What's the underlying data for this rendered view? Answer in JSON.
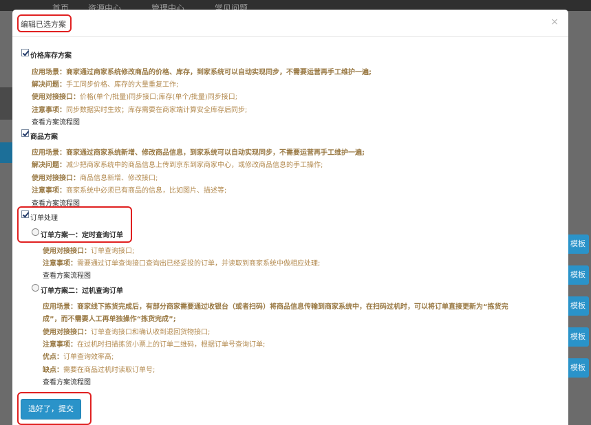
{
  "background": {
    "nav": [
      "首页",
      "资源中心",
      "管理中心",
      "常见问题"
    ],
    "side_button_label": "模板"
  },
  "modal": {
    "title": "编辑已选方案",
    "close_label": "×",
    "sections": [
      {
        "title": "价格库存方案",
        "lines": [
          {
            "label": "应用场景：",
            "text": "商家通过商家系统修改商品的价格、库存，到家系统可以自动实现同步，不需要运营再手工维护一遍;"
          },
          {
            "label": "解决问题：",
            "text": "手工同步价格、库存的大量重复工作;"
          },
          {
            "label": "使用对接接口：",
            "text": "价格(单个/批量)同步接口;库存(单个/批量)同步接口;"
          },
          {
            "label": "注意事项：",
            "text": "同步数据实时生效；库存需要在商家端计算安全库存后同步;"
          }
        ],
        "link": "查看方案流程图"
      },
      {
        "title": "商品方案",
        "lines": [
          {
            "label": "应用场景：",
            "text": "商家通过商家系统新增、修改商品信息，到家系统可以自动实现同步，不需要运营再手工维护一遍;"
          },
          {
            "label": "解决问题：",
            "text": "减少把商家系统中的商品信息上传到京东到家商家中心，或修改商品信息的手工操作;"
          },
          {
            "label": "使用对接接口：",
            "text": "商品信息新增、修改接口;"
          },
          {
            "label": "注意事项：",
            "text": "商家系统中必须已有商品的信息，比如图片、描述等;"
          }
        ],
        "link": "查看方案流程图"
      }
    ],
    "order": {
      "title": "订单处理",
      "option1": {
        "title": "订单方案一：定时查询订单",
        "lines": [
          {
            "label": "使用对接接口：",
            "text": "订单查询接口;"
          },
          {
            "label": "注意事项：",
            "text": "需要通过订单查询接口查询出已经妥投的订单，并读取到商家系统中做相应处理;"
          }
        ],
        "link": "查看方案流程图"
      },
      "option2": {
        "title": "订单方案二：过机查询订单",
        "scenario_label": "应用场景：",
        "scenario_line1": "商家线下拣货完成后，有部分商家需要通过收银台（或者扫码）将商品信息传输到商家系统中，在扫码过机时，可以将订单直接更新为“拣货完",
        "scenario_line2": "成”，而不需要人工再单独操作“拣货完成”;",
        "lines": [
          {
            "label": "使用对接接口：",
            "text": "订单查询接口和确认收到退回货物接口;"
          },
          {
            "label": "注意事项：",
            "text": "在过机时扫描拣货小票上的订单二维码，根据订单号查询订单;"
          },
          {
            "label": "优点：",
            "text": "订单查询效率高;"
          },
          {
            "label": "缺点：",
            "text": "需要在商品过机时读取订单号;"
          }
        ],
        "link": "查看方案流程图"
      }
    },
    "submit_label": "选好了，提交"
  }
}
